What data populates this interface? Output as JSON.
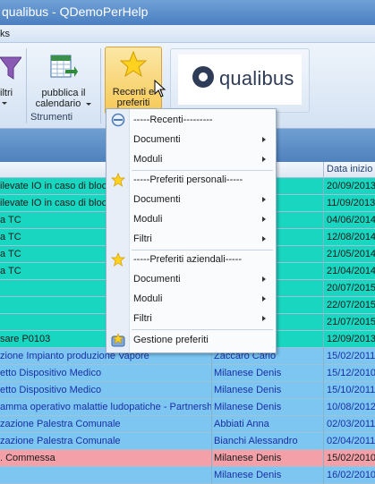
{
  "window": {
    "title": "qualibus  -  QDemoPerHelp"
  },
  "menustrip": {
    "item": "ks"
  },
  "ribbon": {
    "filtri_label": "iltri",
    "pubblica_label_1": "pubblica il",
    "pubblica_label_2": "calendario",
    "recenti_label_1": "Recenti e",
    "recenti_label_2": "preferiti",
    "group_label": "Strumenti",
    "logo_text": "qualibus"
  },
  "grid": {
    "header_col3": "Data inizio",
    "rows": [
      {
        "c1": "ilevate IO in caso di bloc",
        "c2": "Andrea",
        "c3": "20/09/2013",
        "color": "teal"
      },
      {
        "c1": "ilevate IO in caso di bloc",
        "c2": "Andrea",
        "c3": "11/09/2013",
        "color": "teal"
      },
      {
        "c1": "a TC",
        "c2": "ndro",
        "c3": "04/06/2014",
        "color": "teal"
      },
      {
        "c1": "a TC",
        "c2": "s",
        "c3": "12/08/2014",
        "color": "teal"
      },
      {
        "c1": "a TC",
        "c2": "s",
        "c3": "21/05/2014",
        "color": "teal"
      },
      {
        "c1": "a TC",
        "c2": "s",
        "c3": "21/04/2014",
        "color": "teal"
      },
      {
        "c1": "",
        "c2": "s",
        "c3": "20/07/2015",
        "color": "teal"
      },
      {
        "c1": "",
        "c2": "",
        "c3": "22/07/2015",
        "color": "teal"
      },
      {
        "c1": "",
        "c2": "s",
        "c3": "21/07/2015",
        "color": "teal"
      },
      {
        "c1": "sare P0103",
        "c2": "Andrea",
        "c3": "12/09/2013",
        "color": "teal"
      },
      {
        "c1": "zione Impianto produzione Vapore",
        "c2": "Zaccaro Carlo",
        "c3": "15/02/2011",
        "color": "blue"
      },
      {
        "c1": "etto Dispositivo Medico",
        "c2": "Milanese Denis",
        "c3": "15/12/2010",
        "color": "blue"
      },
      {
        "c1": "etto Dispositivo Medico",
        "c2": "Milanese Denis",
        "c3": "15/10/2011",
        "color": "blue"
      },
      {
        "c1": "amma operativo malattie ludopatiche - Partnership",
        "c2": "Milanese Denis",
        "c3": "10/08/2012",
        "color": "blue"
      },
      {
        "c1": "zazione Palestra Comunale",
        "c2": "Abbiati Anna",
        "c3": "02/03/2011",
        "color": "blue"
      },
      {
        "c1": "zazione Palestra Comunale",
        "c2": "Bianchi Alessandro",
        "c3": "02/04/2011",
        "color": "blue"
      },
      {
        "c1": ". Commessa",
        "c2": "Milanese Denis",
        "c3": "15/02/2010",
        "color": "pink"
      },
      {
        "c1": "",
        "c2": "Milanese Denis",
        "c3": "16/02/2010",
        "color": "blue"
      }
    ]
  },
  "dropdown": {
    "recenti_header": "-----Recenti---------",
    "recenti_documenti": "Documenti",
    "recenti_moduli": "Moduli",
    "personali_header": "-----Preferiti personali-----",
    "personali_documenti": "Documenti",
    "personali_moduli": "Moduli",
    "personali_filtri": "Filtri",
    "aziendali_header": "-----Preferiti aziendali-----",
    "aziendali_documenti": "Documenti",
    "aziendali_moduli": "Moduli",
    "aziendali_filtri": "Filtri",
    "gestione": "Gestione preferiti"
  },
  "colors": {
    "teal_row": "#19d6c1",
    "blue_row": "#7cc6f1",
    "pink_row": "#f3a0a8",
    "title_bar": "#4b7fc1"
  }
}
